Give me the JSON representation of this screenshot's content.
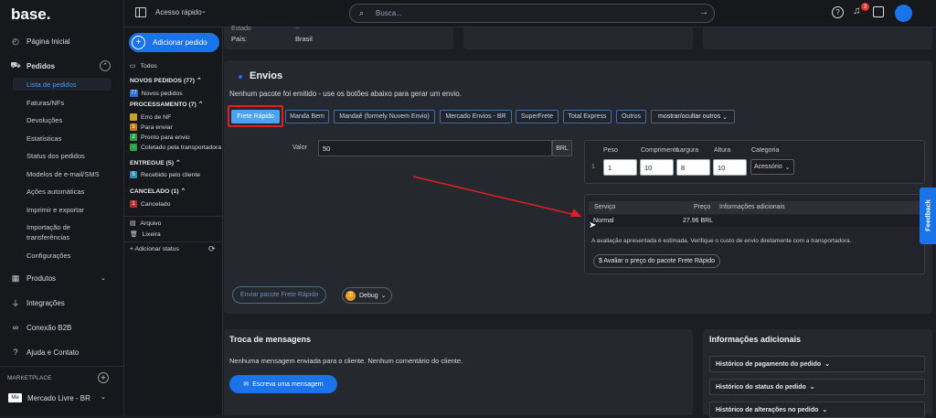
{
  "brand": "base.",
  "sidebar": {
    "items": [
      {
        "label": "Página Inicial",
        "icon": "dashboard-icon"
      },
      {
        "label": "Pedidos",
        "icon": "cart-icon"
      },
      {
        "label": "Produtos",
        "icon": "box-icon"
      },
      {
        "label": "Integrações",
        "icon": "plug-icon"
      },
      {
        "label": "Conexão B2B",
        "icon": "link-icon"
      },
      {
        "label": "Ajuda e Contato",
        "icon": "help-icon"
      }
    ],
    "pedidos_sub": [
      "Lista de pedidos",
      "Faturas/NFs",
      "Devoluções",
      "Estatísticas",
      "Status dos pedidos",
      "Modelos de e-mail/SMS",
      "Ações automáticas",
      "Imprimir e exportar",
      "Importação de",
      "transferências",
      "Configurações"
    ],
    "marketplace_label": "MARKETPLACE",
    "marketplace_item": "Mercado Livre - BR",
    "marketplace_badge": "Me"
  },
  "topbar": {
    "quick_access": "Acesso rápido",
    "search_placeholder": "Busca...",
    "notif_count": "3"
  },
  "middle": {
    "add_order": "Adicionar pedido",
    "all": "Todos",
    "novos_head": "NOVOS PEDIDOS (77)",
    "novos": [
      {
        "badge": "77",
        "label": "Novos pedidos",
        "color": "#2a6fd6"
      }
    ],
    "proc_head": "PROCESSAMENTO (7)",
    "proc": [
      {
        "badge": "",
        "label": "Erro de NF",
        "color": "#c9a227"
      },
      {
        "badge": "5",
        "label": "Para enviar",
        "color": "#c77a1c"
      },
      {
        "badge": "2",
        "label": "Pronto para envio",
        "color": "#2f9e4a"
      },
      {
        "badge": "-",
        "label": "Coletado pela transportadora",
        "color": "#2f9e4a"
      }
    ],
    "entregue_head": "ENTREGUE (5)",
    "entregue": [
      {
        "badge": "5",
        "label": "Recebido pelo cliente",
        "color": "#2a8fb0"
      }
    ],
    "cancel_head": "CANCELADO (1)",
    "cancel": [
      {
        "badge": "1",
        "label": "Cancelado",
        "color": "#b03030"
      }
    ],
    "arquivo": "Arquivo",
    "lixeira": "Lixeira",
    "add_status": "+ Adicionar status"
  },
  "top_card": {
    "estado_label": "Estado",
    "estado_value": "--",
    "pais_label": "País:",
    "pais_value": "Brasil"
  },
  "envios": {
    "title": "Envios",
    "message": "Nenhum pacote foi emitido - use os botões abaixo para gerar um envio.",
    "carriers": [
      "Frete Rápido",
      "Manda Bem",
      "Mandaê (formely Nuvem Envio)",
      "Mercado Envios - BR",
      "SuperFrete",
      "Total Express",
      "Outros"
    ],
    "toggle": "mostrar/ocultar outros",
    "valor_label": "Valor",
    "valor_value": "50",
    "currency": "BRL",
    "pkg_headers": [
      "Peso",
      "Comprimento",
      "Largura",
      "Altura",
      "Categoria"
    ],
    "pkg_row": {
      "index": "1",
      "peso": "1",
      "comprimento": "10",
      "largura": "8",
      "altura": "10",
      "categoria": "Acessório"
    },
    "svc_headers": [
      "Serviço",
      "Preço",
      "Informações adicionais"
    ],
    "svc_row": {
      "servico": "Normal",
      "preco": "27.96 BRL",
      "info": ""
    },
    "note": "A avaliação apresentada é estimada. Verifique o custo de envio diretamente com a transportadora.",
    "evaluate": "$ Avaliar o preço do pacote Frete Rápido",
    "send": "Enviar pacote Frete Rápido",
    "debug": "Debug"
  },
  "messages": {
    "title": "Troca de mensagens",
    "empty": "Nenhuma mensagem enviada para o cliente. Nenhum comentário do cliente.",
    "write": "Escreva uma mensagem"
  },
  "info": {
    "title": "Informações adicionais",
    "items": [
      "Histórico de pagamento do pedido",
      "Histórico do status do pedido",
      "Histórico de alterações no pedido"
    ]
  },
  "feedback": "Feedback",
  "colors": {
    "accent": "#1a73e8",
    "highlight": "#e02020",
    "panel": "#26282f"
  }
}
